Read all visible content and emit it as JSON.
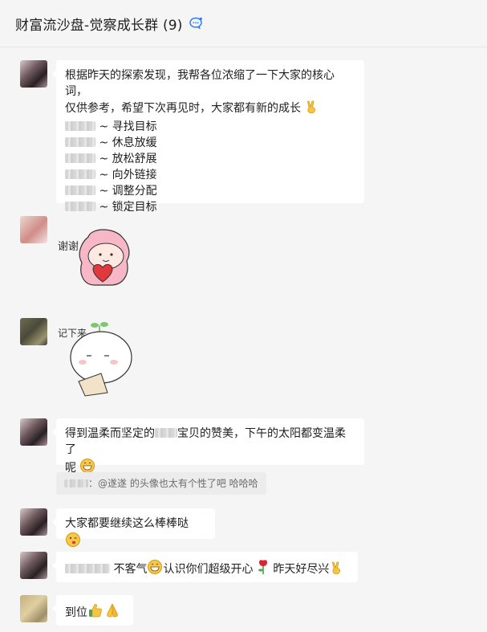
{
  "header": {
    "title": "财富流沙盘-觉察成长群 (9)",
    "icon": "chat-bubble-icon"
  },
  "messages": {
    "m1": {
      "line1": "根据昨天的探索发现，我帮各位浓缩了一下大家的核心词，",
      "line2": "仅供参考，希望下次再见时，大家都有新的成长",
      "items": [
        "~ 寻找目标",
        "~ 休息放缓",
        "~ 放松舒展",
        "~ 向外链接",
        "~ 调整分配",
        "~ 锁定目标"
      ]
    },
    "m2": {
      "sticker_text": "谢谢"
    },
    "m3": {
      "sticker_text": "记下来"
    },
    "m4": {
      "text_a": "得到温柔而坚定的",
      "text_b": "宝贝的赞美，下午的太阳都变温柔了",
      "text_c": "呢"
    },
    "quote": {
      "text": "：@遂遂 的头像也太有个性了吧 哈哈哈"
    },
    "m5": {
      "text": "大家都要继续这么棒棒哒"
    },
    "m6": {
      "text_a": "不客气",
      "text_b": "认识你们超级开心",
      "text_c": "昨天好尽兴"
    },
    "m7": {
      "text": "到位"
    }
  },
  "colors": {
    "background": "#f5f5f5",
    "bubble": "#ffffff",
    "quote_bg": "#ececec",
    "accent_blue": "#2f7cf6"
  }
}
